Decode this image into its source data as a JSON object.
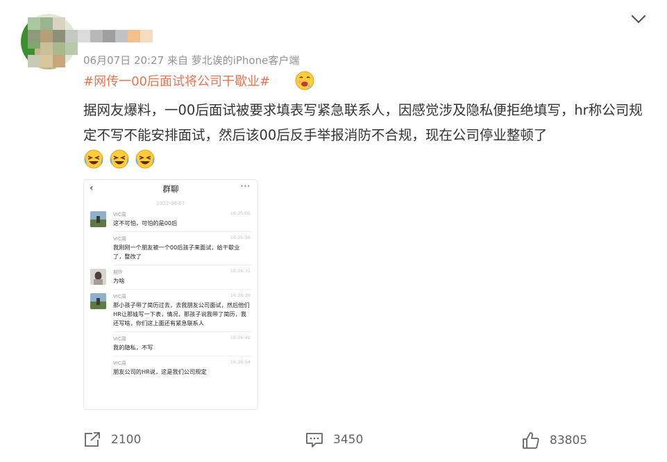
{
  "post": {
    "meta": "06月07日 20:27  来自 萝北诶的iPhone客户端",
    "topic": "#网传一00后面试将公司干歇业#",
    "content": "据网友爆料，一00后面试被要求填表写紧急联系人，因感觉涉及隐私便拒绝填写，hr称公司规定不写不能安排面试，然后该00后反手举报消防不合规，现在公司停业整顿了",
    "topic_emoji": "drool-emoji",
    "trailing_emojis": [
      "laugh-cry-emoji",
      "laugh-cry-emoji",
      "laugh-cry-emoji"
    ]
  },
  "screenshot": {
    "back_icon": "‹",
    "title": "群聊",
    "more_icon": "···",
    "date": "2022-06-07",
    "messages": [
      {
        "name": "VIC周",
        "time": "16:25:05",
        "text": "这不可怕，可怕的是00后",
        "avatar": true
      },
      {
        "name": "VIC周",
        "time": "16:25:26",
        "text": "我刚刚一个朋友被一个00后孩子来面试，给干歇业了，整改了",
        "avatar": false
      },
      {
        "name": "期许",
        "time": "16:26:31",
        "text": "为啥",
        "avatar": true
      },
      {
        "name": "VIC周",
        "time": "16:26:36",
        "text": "那小孩子带了简历过去，去我朋友公司面试，然后他们HR让那娃写一下表，情况，那孩子说我带了简历，我还写啥，你们这上面还有紧急联系人",
        "avatar": true
      },
      {
        "name": "VIC周",
        "time": "16:26:42",
        "text": "我的隐私，不写",
        "avatar": false
      },
      {
        "name": "VIC周",
        "time": "16:26:54",
        "text": "朋友公司的HR说，这是我们公司规定",
        "avatar": false
      }
    ]
  },
  "actions": {
    "share_count": "2100",
    "comment_count": "3450",
    "like_count": "83805"
  },
  "colors": {
    "topic": "#eb7350",
    "meta": "#939393",
    "text": "#333333",
    "action": "#636363"
  }
}
